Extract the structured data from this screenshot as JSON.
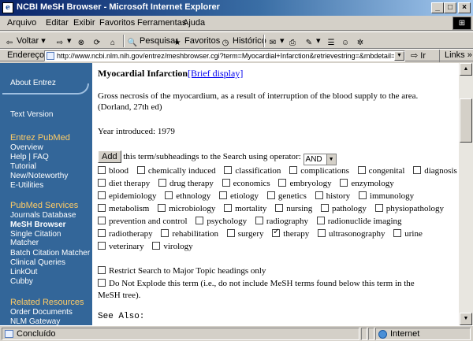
{
  "window": {
    "title": "NCBI MeSH Browser - Microsoft Internet Explorer",
    "minimize": "_",
    "maximize": "□",
    "close": "×"
  },
  "menu": [
    "Arquivo",
    "Editar",
    "Exibir",
    "Favoritos",
    "Ferramentas",
    "Ajuda"
  ],
  "toolbar": {
    "back": "Voltar",
    "search": "Pesquisar",
    "favorites": "Favoritos",
    "history": "Histórico"
  },
  "address": {
    "label": "Endereço",
    "url": "http://www.ncbi.nlm.nih.gov/entrez/meshbrowser.cgi?term=Myocardial+Infarction&retrievestring=&mbdetail=y",
    "go": "Ir",
    "links": "Links"
  },
  "sidebar": {
    "about": "About Entrez",
    "text_version": "Text Version",
    "pubmed_head": "Entrez PubMed",
    "pubmed_items": [
      "Overview",
      "Help | FAQ",
      "Tutorial",
      "New/Noteworthy",
      "E-Utilities"
    ],
    "services_head": "PubMed Services",
    "services_items": [
      "Journals Database",
      "MeSH Browser",
      "Single Citation Matcher",
      "Batch Citation Matcher",
      "Clinical Queries",
      "LinkOut",
      "Cubby"
    ],
    "related_head": "Related Resources",
    "related_items": [
      "Order Documents",
      "NLM Gateway"
    ]
  },
  "content": {
    "term": "Myocardial Infarction",
    "brief_link": "[Brief display]",
    "definition": "Gross necrosis of the myocardium, as a result of interruption of the blood supply to the area.",
    "source": "(Dorland, 27th ed)",
    "year": "Year introduced: 1979",
    "add_button": "Add",
    "add_text": "this term/subheadings to the Search using operator:",
    "operator": "AND",
    "subheadings": [
      [
        "blood",
        "chemically induced",
        "classification",
        "complications",
        "congenital",
        "diagnosis"
      ],
      [
        "diet therapy",
        "drug therapy",
        "economics",
        "embryology",
        "enzymology"
      ],
      [
        "epidemiology",
        "ethnology",
        "etiology",
        "genetics",
        "history",
        "immunology"
      ],
      [
        "metabolism",
        "microbiology",
        "mortality",
        "nursing",
        "pathology",
        "physiopathology"
      ],
      [
        "prevention and control",
        "psychology",
        "radiography",
        "radionuclide imaging"
      ],
      [
        "radiotherapy",
        "rehabilitation",
        "surgery",
        "therapy",
        "ultrasonography",
        "urine"
      ],
      [
        "veterinary",
        "virology"
      ]
    ],
    "checked": "therapy",
    "restrict": "Restrict Search to Major Topic headings only",
    "noexplode_1": "Do Not Explode this term (i.e., do not include MeSH terms found below this term in the",
    "noexplode_2": "MeSH tree).",
    "see_also": "See Also:"
  },
  "status": {
    "text": "Concluído",
    "zone": "Internet"
  }
}
